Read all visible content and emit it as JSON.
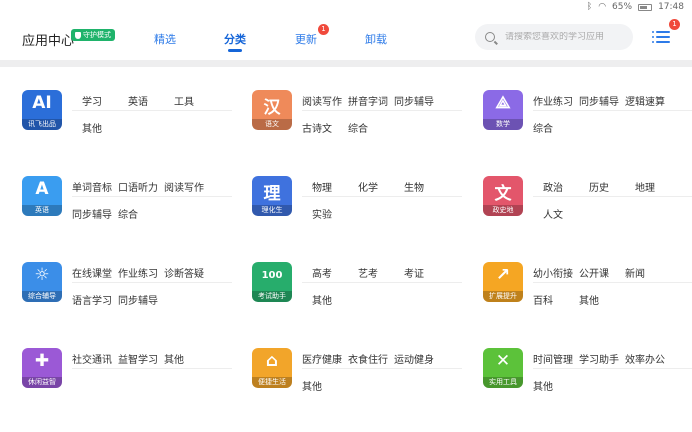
{
  "status_bar": {
    "battery": "65%",
    "time": "17:48"
  },
  "header": {
    "title": "应用中心",
    "guard_badge": "守护模式",
    "tabs": [
      {
        "label": "精选"
      },
      {
        "label": "分类"
      },
      {
        "label": "更新",
        "badge": "1"
      },
      {
        "label": "卸载"
      }
    ],
    "search_placeholder": "请搜索您喜欢的学习应用",
    "menu_badge": "1"
  },
  "categories": [
    {
      "name": "讯飞出品",
      "glyph": "AI",
      "color": "#2b6ed9",
      "tags": [
        "学习",
        "英语",
        "工具",
        "其他"
      ]
    },
    {
      "name": "语文",
      "glyph": "汉",
      "color": "#ef8a5a",
      "tags": [
        "阅读写作",
        "拼音字词",
        "同步辅导",
        "古诗文",
        "综合"
      ]
    },
    {
      "name": "数学",
      "glyph": "⟁",
      "color": "#8b6ae6",
      "tags": [
        "作业练习",
        "同步辅导",
        "逻辑速算",
        "综合"
      ]
    },
    {
      "name": "英语",
      "glyph": "A",
      "color": "#3a9df0",
      "tags": [
        "单词音标",
        "口语听力",
        "阅读写作",
        "同步辅导",
        "综合"
      ]
    },
    {
      "name": "理化生",
      "glyph": "理",
      "color": "#3f72de",
      "tags": [
        "物理",
        "化学",
        "生物",
        "实验"
      ]
    },
    {
      "name": "政史地",
      "glyph": "文",
      "color": "#e3566b",
      "tags": [
        "政治",
        "历史",
        "地理",
        "人文"
      ]
    },
    {
      "name": "综合辅导",
      "glyph": "☼",
      "color": "#3b8ee8",
      "tags": [
        "在线课堂",
        "作业练习",
        "诊断答疑",
        "语言学习",
        "同步辅导"
      ]
    },
    {
      "name": "考试助手",
      "glyph": "100",
      "color": "#27ad6c",
      "tags": [
        "高考",
        "艺考",
        "考证",
        "其他"
      ]
    },
    {
      "name": "扩展提升",
      "glyph": "↗",
      "color": "#f5a623",
      "tags": [
        "幼小衔接",
        "公开课",
        "新闻",
        "百科",
        "其他"
      ]
    },
    {
      "name": "休闲益智",
      "glyph": "✚",
      "color": "#9b59d6",
      "tags": [
        "社交通讯",
        "益智学习",
        "其他"
      ]
    },
    {
      "name": "便捷生活",
      "glyph": "⌂",
      "color": "#f2a52a",
      "tags": [
        "医疗健康",
        "衣食住行",
        "运动健身",
        "其他"
      ]
    },
    {
      "name": "实用工具",
      "glyph": "✕",
      "color": "#5cc23a",
      "tags": [
        "时间管理",
        "学习助手",
        "效率办公",
        "其他"
      ]
    }
  ]
}
